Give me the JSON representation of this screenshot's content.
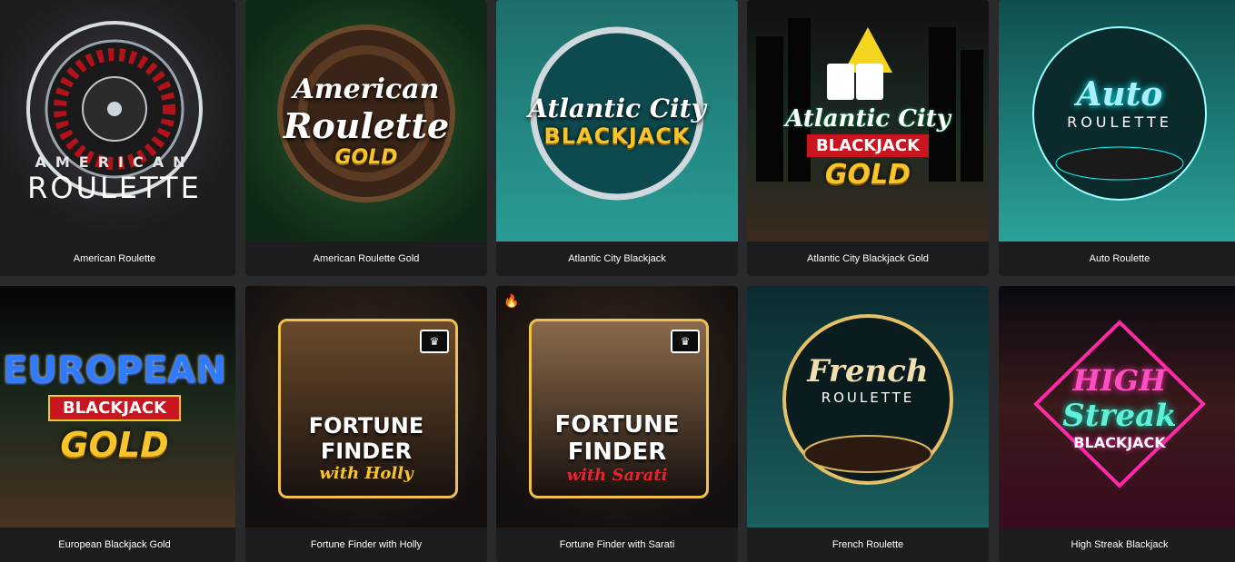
{
  "games": [
    {
      "title": "American Roulette",
      "art": [
        "AMERICAN",
        "ROULETTE"
      ]
    },
    {
      "title": "American Roulette Gold",
      "art": [
        "American",
        "Roulette",
        "GOLD"
      ]
    },
    {
      "title": "Atlantic City Blackjack",
      "art": [
        "Atlantic City",
        "BLACKJACK"
      ]
    },
    {
      "title": "Atlantic City Blackjack Gold",
      "art": [
        "Atlantic City",
        "BLACKJACK",
        "GOLD"
      ]
    },
    {
      "title": "Auto Roulette",
      "art": [
        "Auto",
        "ROULETTE"
      ]
    },
    {
      "title": "European Blackjack Gold",
      "art": [
        "EUROPEAN",
        "BLACKJACK",
        "GOLD"
      ]
    },
    {
      "title": "Fortune Finder with Holly",
      "art": [
        "FORTUNE",
        "FINDER",
        "with Holly"
      ]
    },
    {
      "title": "Fortune Finder with Sarati",
      "art": [
        "FORTUNE",
        "FINDER",
        "with Sarati"
      ]
    },
    {
      "title": "French Roulette",
      "art": [
        "French",
        "ROULETTE"
      ]
    },
    {
      "title": "High Streak Blackjack",
      "art": [
        "HIGH",
        "Streak",
        "BLACKJACK"
      ]
    }
  ],
  "icons": {
    "crown": "crown-icon",
    "flame": "flame-icon"
  },
  "colors": {
    "page_bg": "#2a2a2d",
    "caption_bg": "#1c1c1f",
    "caption_text": "#ffffff",
    "gold": "#f7c52a"
  }
}
